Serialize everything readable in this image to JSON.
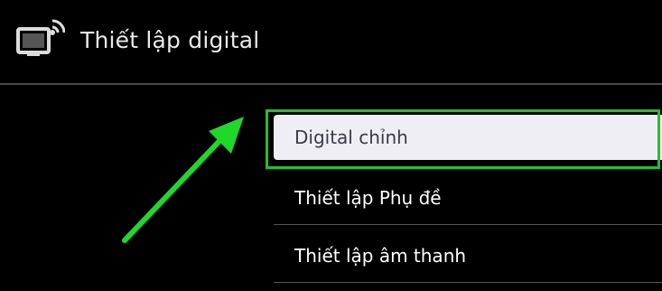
{
  "header": {
    "icon": "tv-settings-icon",
    "title": "Thiết lập digital"
  },
  "menu": {
    "items": [
      {
        "label": "Digital chỉnh",
        "selected": true
      },
      {
        "label": "Thiết lập Phụ đề",
        "selected": false
      },
      {
        "label": "Thiết lập âm thanh",
        "selected": false
      }
    ]
  },
  "annotation": {
    "arrow_color": "#1fd82a",
    "highlight_color": "#22c12a"
  },
  "colors": {
    "background": "#000000",
    "selected_bg": "#eeeef4",
    "selected_text": "#3a3a4a"
  }
}
